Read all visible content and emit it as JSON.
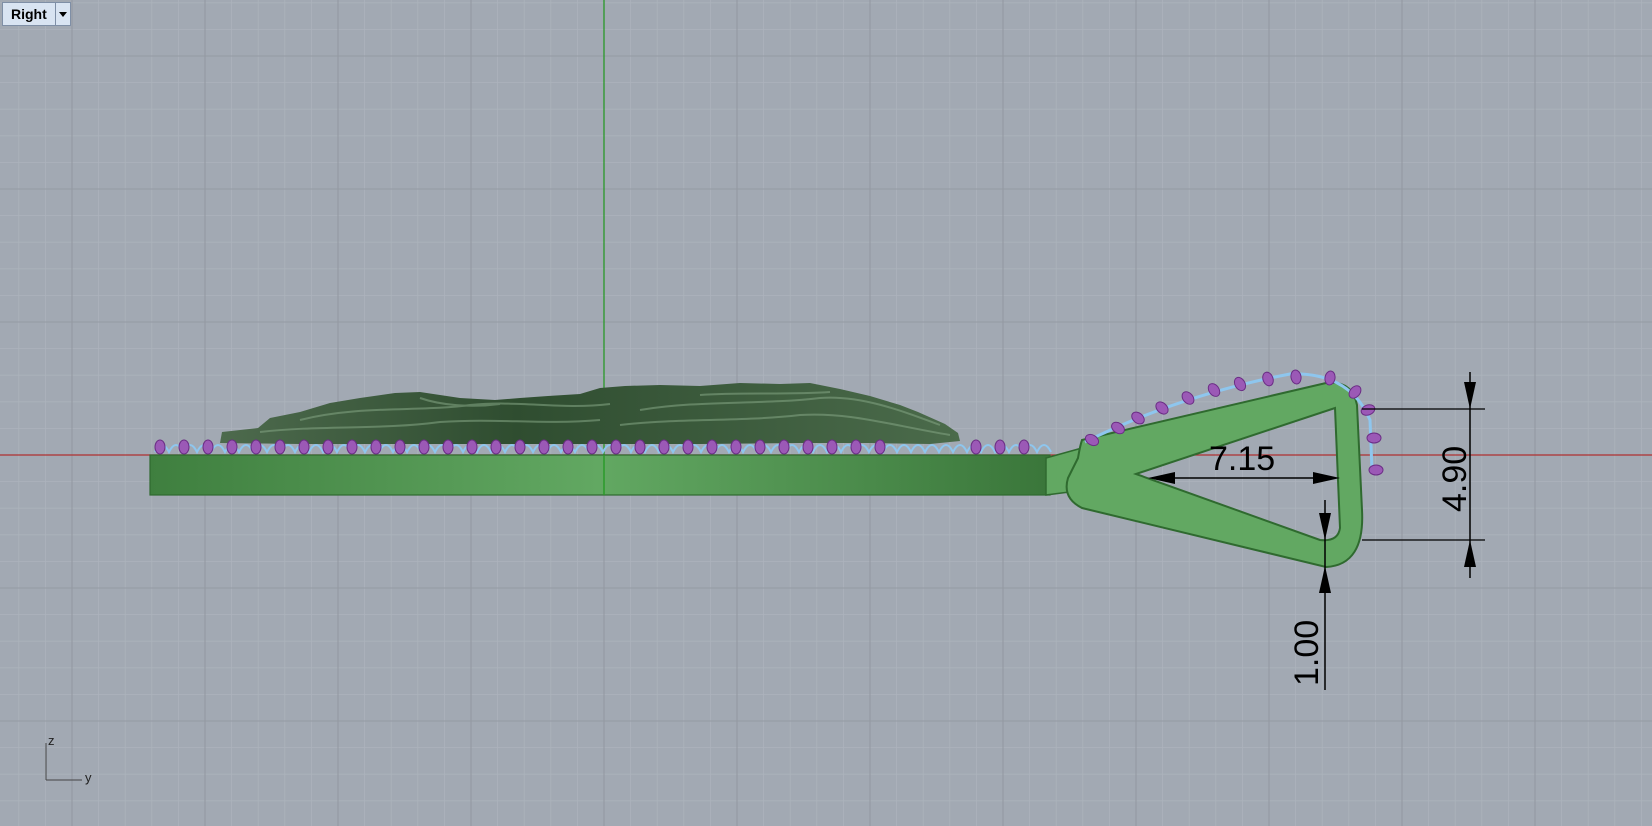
{
  "viewport": {
    "name": "Right",
    "menu_icon": "chevron-down-icon"
  },
  "dimensions": {
    "length": "7.15",
    "height": "4.90",
    "thickness": "1.00"
  },
  "axes": {
    "vertical": "z",
    "horizontal": "y"
  },
  "colors": {
    "background": "#a2a9b3",
    "grid_minor": "#acb3bc",
    "grid_major": "#949aa3",
    "x_axis": "#b03030",
    "z_axis": "#2a9a2a",
    "model_green": "#5aa55a",
    "relief_green": "#3e5e3e",
    "prong_purple": "#9b59b6",
    "wire_blue": "#8ec6ee"
  }
}
